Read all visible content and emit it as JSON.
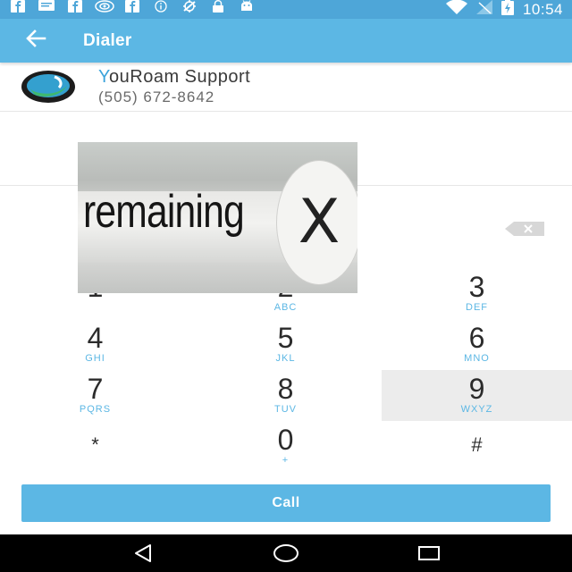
{
  "status_bar": {
    "time": "10:54",
    "icons": [
      "facebook-icon",
      "message-icon",
      "facebook-icon",
      "eye-icon",
      "facebook-icon",
      "info-icon",
      "no-location-icon",
      "lock-icon",
      "android-icon"
    ],
    "right_icons": [
      "wifi-icon",
      "no-signal-icon",
      "battery-charging-icon"
    ]
  },
  "app_bar": {
    "title": "Dialer",
    "back_icon": "arrow-back-icon",
    "color": "#5cb7e4"
  },
  "contact": {
    "name_first_letter": "Y",
    "name_rest": "ouRoam Support",
    "number": "(505) 672-8642"
  },
  "overlay_ad": {
    "text": "remaining",
    "close_glyph": "X"
  },
  "keypad": {
    "keys": [
      {
        "digit": "1",
        "letters": ""
      },
      {
        "digit": "2",
        "letters": "ABC"
      },
      {
        "digit": "3",
        "letters": "DEF"
      },
      {
        "digit": "4",
        "letters": "GHI"
      },
      {
        "digit": "5",
        "letters": "JKL"
      },
      {
        "digit": "6",
        "letters": "MNO"
      },
      {
        "digit": "7",
        "letters": "PQRS"
      },
      {
        "digit": "8",
        "letters": "TUV"
      },
      {
        "digit": "9",
        "letters": "WXYZ"
      },
      {
        "digit": "*",
        "letters": ""
      },
      {
        "digit": "0",
        "letters": "+"
      },
      {
        "digit": "#",
        "letters": ""
      }
    ]
  },
  "call_button": {
    "label": "Call"
  },
  "nav_bar": {
    "icons": [
      "back-triangle-icon",
      "home-circle-icon",
      "recents-square-icon"
    ]
  }
}
